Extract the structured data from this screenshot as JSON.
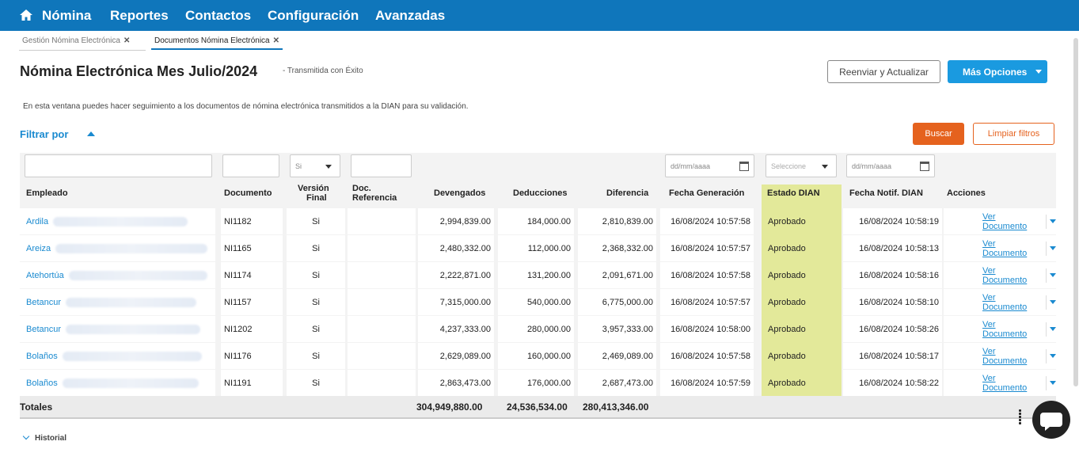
{
  "nav": {
    "items": [
      "Nómina",
      "Reportes",
      "Contactos",
      "Configuración",
      "Avanzadas"
    ]
  },
  "tabs": [
    {
      "label": "Gestión Nómina Electrónica"
    },
    {
      "label": "Documentos Nómina Electrónica"
    }
  ],
  "header": {
    "title": "Nómina Electrónica Mes Julio/2024",
    "subtitle": "- Transmitida con Éxito",
    "resend_label": "Reenviar y Actualizar",
    "more_label": "Más Opciones"
  },
  "description": "En esta ventana puedes hacer seguimiento a los documentos de nómina electrónica transmitidos a la DIAN para su validación.",
  "filters": {
    "label": "Filtrar por",
    "buscar": "Buscar",
    "limpiar": "Limpiar filtros",
    "version_value": "Si",
    "date_placeholder": "dd/mm/aaaa",
    "estado_placeholder": "Seleccione"
  },
  "columns": {
    "empleado": "Empleado",
    "documento": "Documento",
    "version_1": "Versión",
    "version_2": "Final",
    "docref_1": "Doc.",
    "docref_2": "Referencia",
    "devengados": "Devengados",
    "deducciones": "Deducciones",
    "diferencia": "Diferencia",
    "fecha_gen": "Fecha Generación",
    "estado": "Estado DIAN",
    "fecha_notif": "Fecha Notif. DIAN",
    "acciones": "Acciones"
  },
  "rows": [
    {
      "empleado": "Ardila",
      "documento": "NI1182",
      "version": "Si",
      "devengados": "2,994,839.00",
      "deducciones": "184,000.00",
      "diferencia": "2,810,839.00",
      "fecha_gen": "16/08/2024 10:57:58",
      "estado": "Aprobado",
      "fecha_notif": "16/08/2024 10:58:19",
      "accion": "Ver Documento"
    },
    {
      "empleado": "Areiza",
      "documento": "NI1165",
      "version": "Si",
      "devengados": "2,480,332.00",
      "deducciones": "112,000.00",
      "diferencia": "2,368,332.00",
      "fecha_gen": "16/08/2024 10:57:57",
      "estado": "Aprobado",
      "fecha_notif": "16/08/2024 10:58:13",
      "accion": "Ver Documento"
    },
    {
      "empleado": "Atehortúa",
      "documento": "NI1174",
      "version": "Si",
      "devengados": "2,222,871.00",
      "deducciones": "131,200.00",
      "diferencia": "2,091,671.00",
      "fecha_gen": "16/08/2024 10:57:58",
      "estado": "Aprobado",
      "fecha_notif": "16/08/2024 10:58:16",
      "accion": "Ver Documento"
    },
    {
      "empleado": "Betancur",
      "documento": "NI1157",
      "version": "Si",
      "devengados": "7,315,000.00",
      "deducciones": "540,000.00",
      "diferencia": "6,775,000.00",
      "fecha_gen": "16/08/2024 10:57:57",
      "estado": "Aprobado",
      "fecha_notif": "16/08/2024 10:58:10",
      "accion": "Ver Documento"
    },
    {
      "empleado": "Betancur",
      "documento": "NI1202",
      "version": "Si",
      "devengados": "4,237,333.00",
      "deducciones": "280,000.00",
      "diferencia": "3,957,333.00",
      "fecha_gen": "16/08/2024 10:58:00",
      "estado": "Aprobado",
      "fecha_notif": "16/08/2024 10:58:26",
      "accion": "Ver Documento"
    },
    {
      "empleado": "Bolaños",
      "documento": "NI1176",
      "version": "Si",
      "devengados": "2,629,089.00",
      "deducciones": "160,000.00",
      "diferencia": "2,469,089.00",
      "fecha_gen": "16/08/2024 10:57:58",
      "estado": "Aprobado",
      "fecha_notif": "16/08/2024 10:58:17",
      "accion": "Ver Documento"
    },
    {
      "empleado": "Bolaños",
      "documento": "NI1191",
      "version": "Si",
      "devengados": "2,863,473.00",
      "deducciones": "176,000.00",
      "diferencia": "2,687,473.00",
      "fecha_gen": "16/08/2024 10:57:59",
      "estado": "Aprobado",
      "fecha_notif": "16/08/2024 10:58:22",
      "accion": "Ver Documento"
    }
  ],
  "totals": {
    "label": "Totales",
    "devengados": "304,949,880.00",
    "deducciones": "24,536,534.00",
    "diferencia": "280,413,346.00"
  },
  "historial": "Historial",
  "colors": {
    "nav": "#0f76bb",
    "accent": "#1a9ae0",
    "orange": "#e5621e",
    "highlight": "#e3e99a"
  }
}
